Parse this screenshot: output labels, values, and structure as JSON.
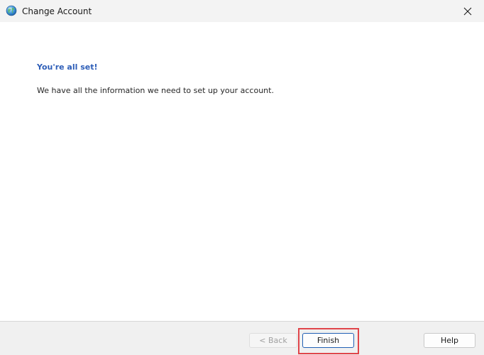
{
  "window": {
    "title": "Change Account",
    "app_icon": "globe-icon",
    "close_icon": "close-icon"
  },
  "content": {
    "heading": "You're all set!",
    "message": "We have all the information we need to set up your account."
  },
  "footer": {
    "back_label": "< Back",
    "finish_label": "Finish",
    "help_label": "Help"
  },
  "colors": {
    "heading": "#2e5eb8",
    "finish_border": "#1f5fb3",
    "highlight": "#e0454a"
  }
}
